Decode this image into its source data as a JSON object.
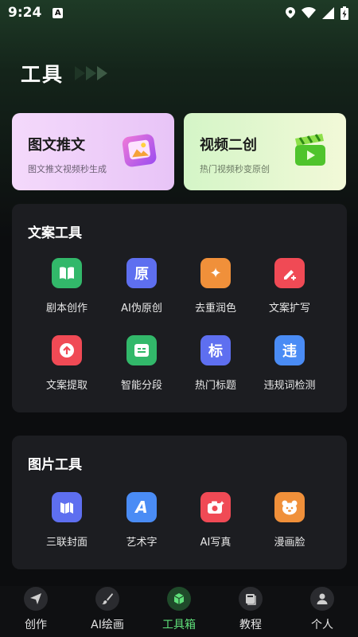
{
  "status_bar": {
    "time": "9:24",
    "notification_letter": "A"
  },
  "header": {
    "title": "工具"
  },
  "features": [
    {
      "title": "图文推文",
      "subtitle": "图文推文视频秒生成",
      "icon": "image-frame-icon",
      "accent": "#c86ff0"
    },
    {
      "title": "视频二创",
      "subtitle": "热门视频秒变原创",
      "icon": "clapperboard-icon",
      "accent": "#6dd63c"
    }
  ],
  "copy_tools": {
    "title": "文案工具",
    "items": [
      {
        "label": "剧本创作",
        "icon": "book-icon",
        "glyph": "",
        "color": "#32b86a"
      },
      {
        "label": "AI伪原创",
        "icon": "yuan-icon",
        "glyph": "原",
        "color": "#5e6ff0"
      },
      {
        "label": "去重润色",
        "icon": "sparkle-icon",
        "glyph": "✦",
        "color": "#f0903a"
      },
      {
        "label": "文案扩写",
        "icon": "pen-plus-icon",
        "glyph": "",
        "color": "#f04a55"
      },
      {
        "label": "文案提取",
        "icon": "upload-icon",
        "glyph": "",
        "color": "#f04a55"
      },
      {
        "label": "智能分段",
        "icon": "paragraph-icon",
        "glyph": "",
        "color": "#32b86a"
      },
      {
        "label": "热门标题",
        "icon": "biao-icon",
        "glyph": "标",
        "color": "#5e6ff0"
      },
      {
        "label": "违规词检测",
        "icon": "wei-icon",
        "glyph": "违",
        "color": "#4a8cf5"
      }
    ]
  },
  "image_tools": {
    "title": "图片工具",
    "items": [
      {
        "label": "三联封面",
        "icon": "triptych-icon",
        "glyph": "",
        "color": "#5e6ff0"
      },
      {
        "label": "艺术字",
        "icon": "art-a-icon",
        "glyph": "A",
        "color": "#4a8cf5"
      },
      {
        "label": "AI写真",
        "icon": "camera-icon",
        "glyph": "",
        "color": "#f04a55"
      },
      {
        "label": "漫画脸",
        "icon": "bear-face-icon",
        "glyph": "",
        "color": "#f0903a"
      }
    ]
  },
  "bottom_nav": {
    "items": [
      {
        "label": "创作",
        "icon": "paper-plane-icon"
      },
      {
        "label": "AI绘画",
        "icon": "brush-icon"
      },
      {
        "label": "工具箱",
        "icon": "cube-icon",
        "active": true
      },
      {
        "label": "教程",
        "icon": "book-stack-icon"
      },
      {
        "label": "个人",
        "icon": "user-icon"
      }
    ]
  }
}
